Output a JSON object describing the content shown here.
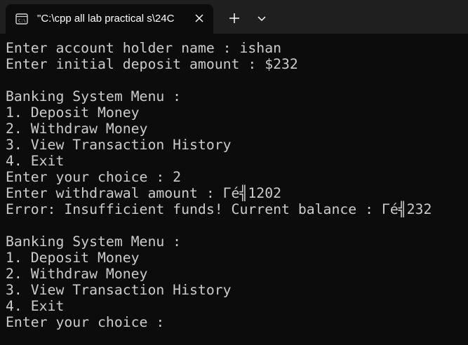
{
  "window": {
    "tab_title": "\"C:\\cpp all lab practical s\\24C",
    "tab_icon": "terminal-icon",
    "close_icon": "close-icon",
    "new_tab_icon": "plus-icon",
    "dropdown_icon": "chevron-down-icon"
  },
  "colors": {
    "background": "#0c0c0c",
    "titlebar": "#1f1f1f",
    "text": "#cccccc"
  },
  "terminal": {
    "lines": [
      "Enter account holder name : ishan",
      "Enter initial deposit amount : $232",
      "",
      "Banking System Menu :",
      "1. Deposit Money",
      "2. Withdraw Money",
      "3. View Transaction History",
      "4. Exit",
      "Enter your choice : 2",
      "Enter withdrawal amount : Γé╣1202",
      "Error: Insufficient funds! Current balance : Γé╣232",
      "",
      "Banking System Menu :",
      "1. Deposit Money",
      "2. Withdraw Money",
      "3. View Transaction History",
      "4. Exit",
      "Enter your choice : "
    ]
  }
}
